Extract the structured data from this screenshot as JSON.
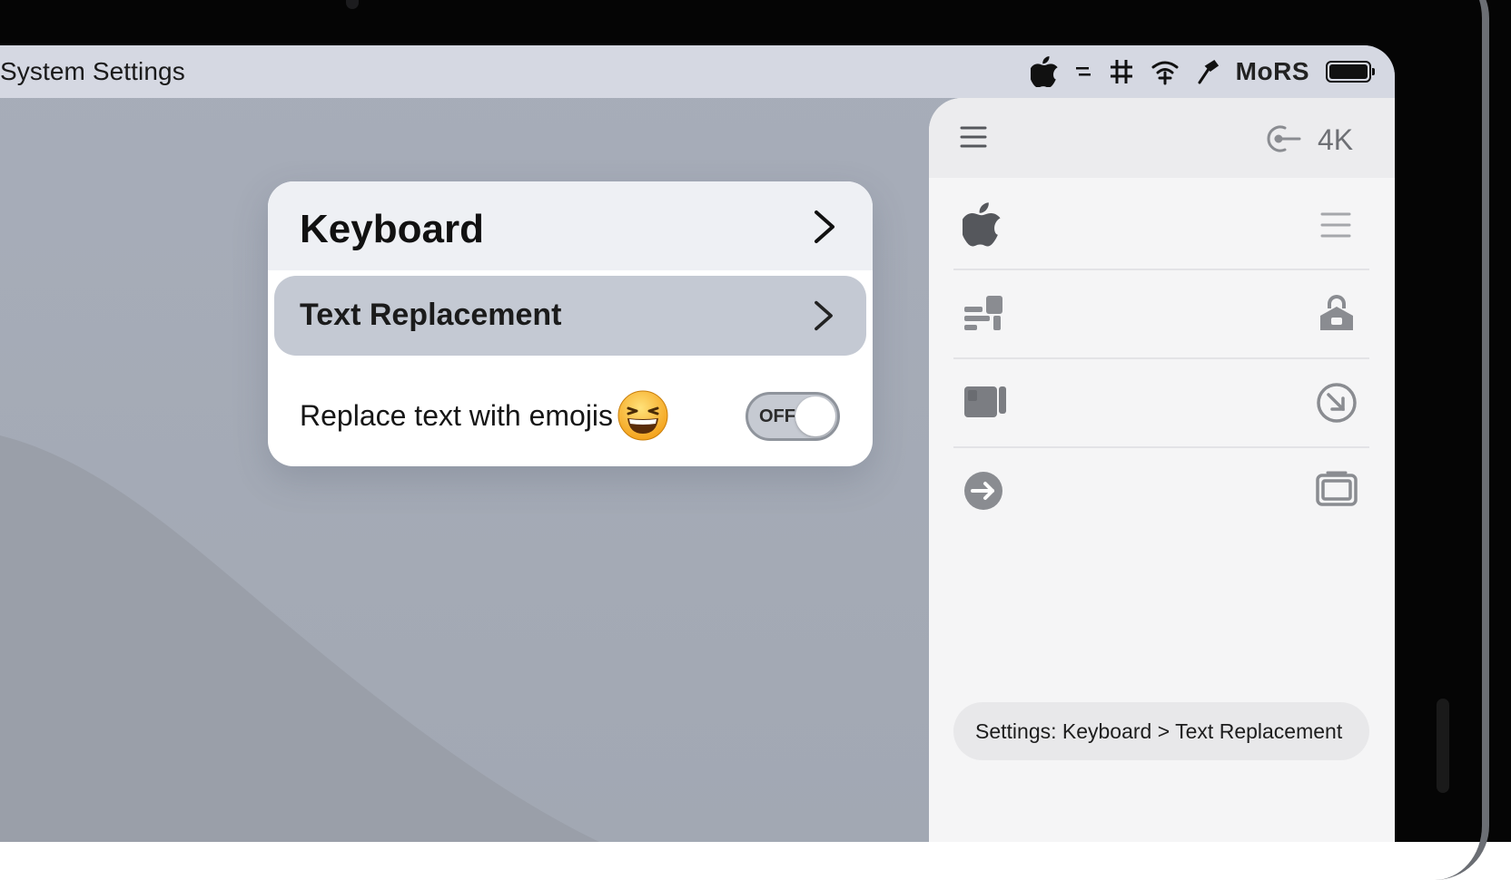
{
  "menubar": {
    "title": "System Settings",
    "status_text": "MoRS",
    "icons": [
      "apple-logo-icon",
      "control-center-icon",
      "hash-icon",
      "wifi-icon",
      "pen-icon",
      "battery-icon"
    ]
  },
  "settings_card": {
    "header_label": "Keyboard",
    "selected_label": "Text Replacement",
    "toggle_row_label": "Replace text with emojis",
    "toggle_state_label": "OFF",
    "toggle_on": false
  },
  "side_panel": {
    "header_badge": "4K",
    "header_icons": [
      "hamburger-menu-icon",
      "power-key-icon"
    ],
    "rows": [
      {
        "left_icon": "apple-logo-icon",
        "right_icon": "list-icon"
      },
      {
        "left_icon": "stack-bars-icon",
        "right_icon": "lock-house-icon"
      },
      {
        "left_icon": "window-split-icon",
        "right_icon": "arrow-circle-icon"
      },
      {
        "left_icon": "arrow-right-circle-icon",
        "right_icon": "display-icon"
      }
    ],
    "status_pill": "Settings: Keyboard > Text Replacement"
  },
  "colors": {
    "wallpaper": "#a7adb9",
    "menubar": "#d5d8e2",
    "selected_row": "#c4c9d3",
    "panel": "#f5f5f6"
  }
}
